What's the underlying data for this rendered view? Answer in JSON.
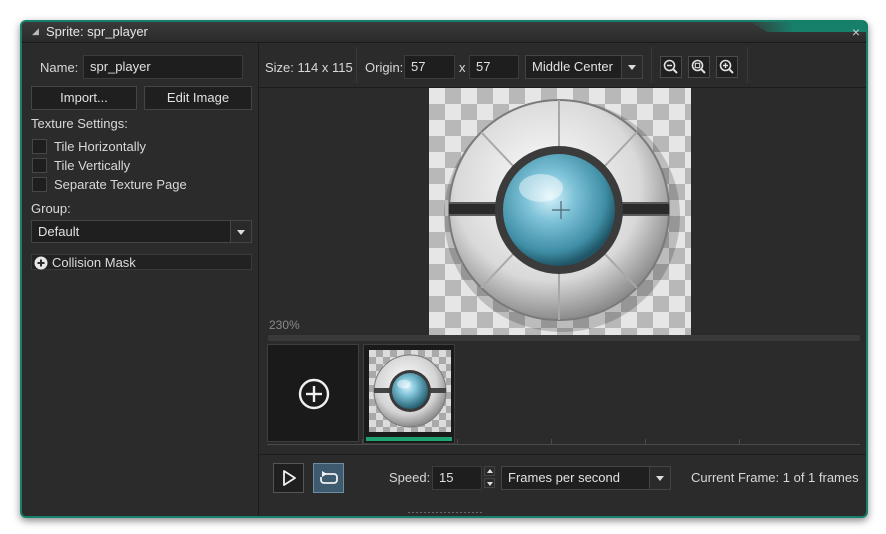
{
  "window": {
    "title": "Sprite: spr_player",
    "close_glyph": "×",
    "accent_color": "#17806b"
  },
  "left_panel": {
    "name_label": "Name:",
    "name_value": "spr_player",
    "import_label": "Import...",
    "edit_image_label": "Edit Image",
    "texture_settings_label": "Texture Settings:",
    "checkboxes": [
      {
        "label": "Tile Horizontally",
        "checked": false
      },
      {
        "label": "Tile Vertically",
        "checked": false
      },
      {
        "label": "Separate Texture Page",
        "checked": false
      }
    ],
    "group_label": "Group:",
    "group_value": "Default",
    "collision_mask_label": "Collision Mask"
  },
  "toolbar": {
    "size_text": "Size: 114 x 115",
    "origin_label": "Origin:",
    "origin_x": "57",
    "origin_sep": "x",
    "origin_y": "57",
    "origin_preset": "Middle Center",
    "zoom_icons": [
      "zoom-out-icon",
      "zoom-reset-icon",
      "zoom-in-icon"
    ]
  },
  "canvas": {
    "zoom_label": "230%"
  },
  "playback": {
    "speed_label": "Speed:",
    "speed_value": "15",
    "speed_unit": "Frames per second",
    "current_frame_text": "Current Frame: 1 of 1 frames"
  }
}
